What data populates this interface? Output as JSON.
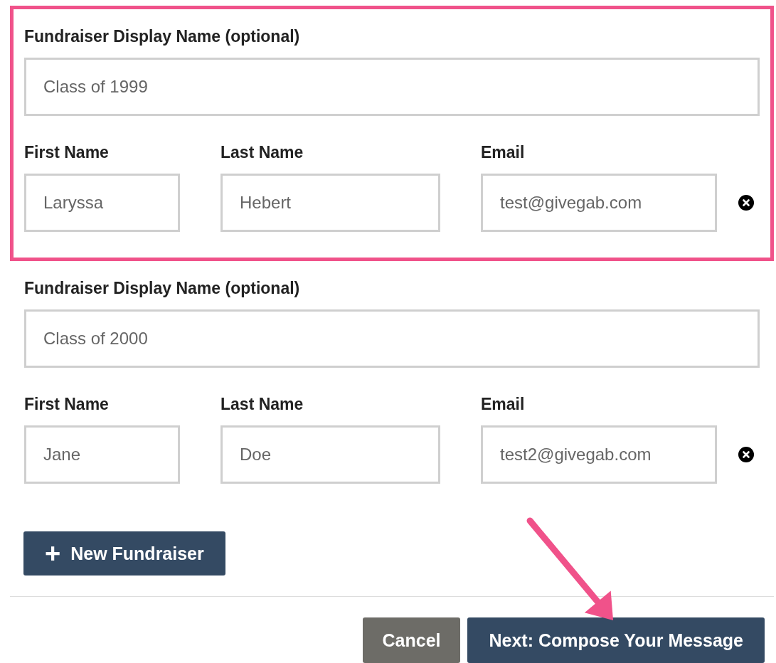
{
  "fundraisers": [
    {
      "highlighted": true,
      "display_name": {
        "label": "Fundraiser Display Name (optional)",
        "value": "Class of 1999"
      },
      "first_name": {
        "label": "First Name",
        "value": "Laryssa"
      },
      "last_name": {
        "label": "Last Name",
        "value": "Hebert"
      },
      "email": {
        "label": "Email",
        "value": "test@givegab.com"
      }
    },
    {
      "highlighted": false,
      "display_name": {
        "label": "Fundraiser Display Name (optional)",
        "value": "Class of 2000"
      },
      "first_name": {
        "label": "First Name",
        "value": "Jane"
      },
      "last_name": {
        "label": "Last Name",
        "value": "Doe"
      },
      "email": {
        "label": "Email",
        "value": "test2@givegab.com"
      }
    }
  ],
  "add_button": {
    "icon": "+",
    "label": "New Fundraiser"
  },
  "footer_buttons": [
    {
      "kind": "secondary",
      "label": "Cancel",
      "pointed_at": false
    },
    {
      "kind": "primary",
      "label": "Next: Compose Your Message",
      "pointed_at": true
    }
  ]
}
